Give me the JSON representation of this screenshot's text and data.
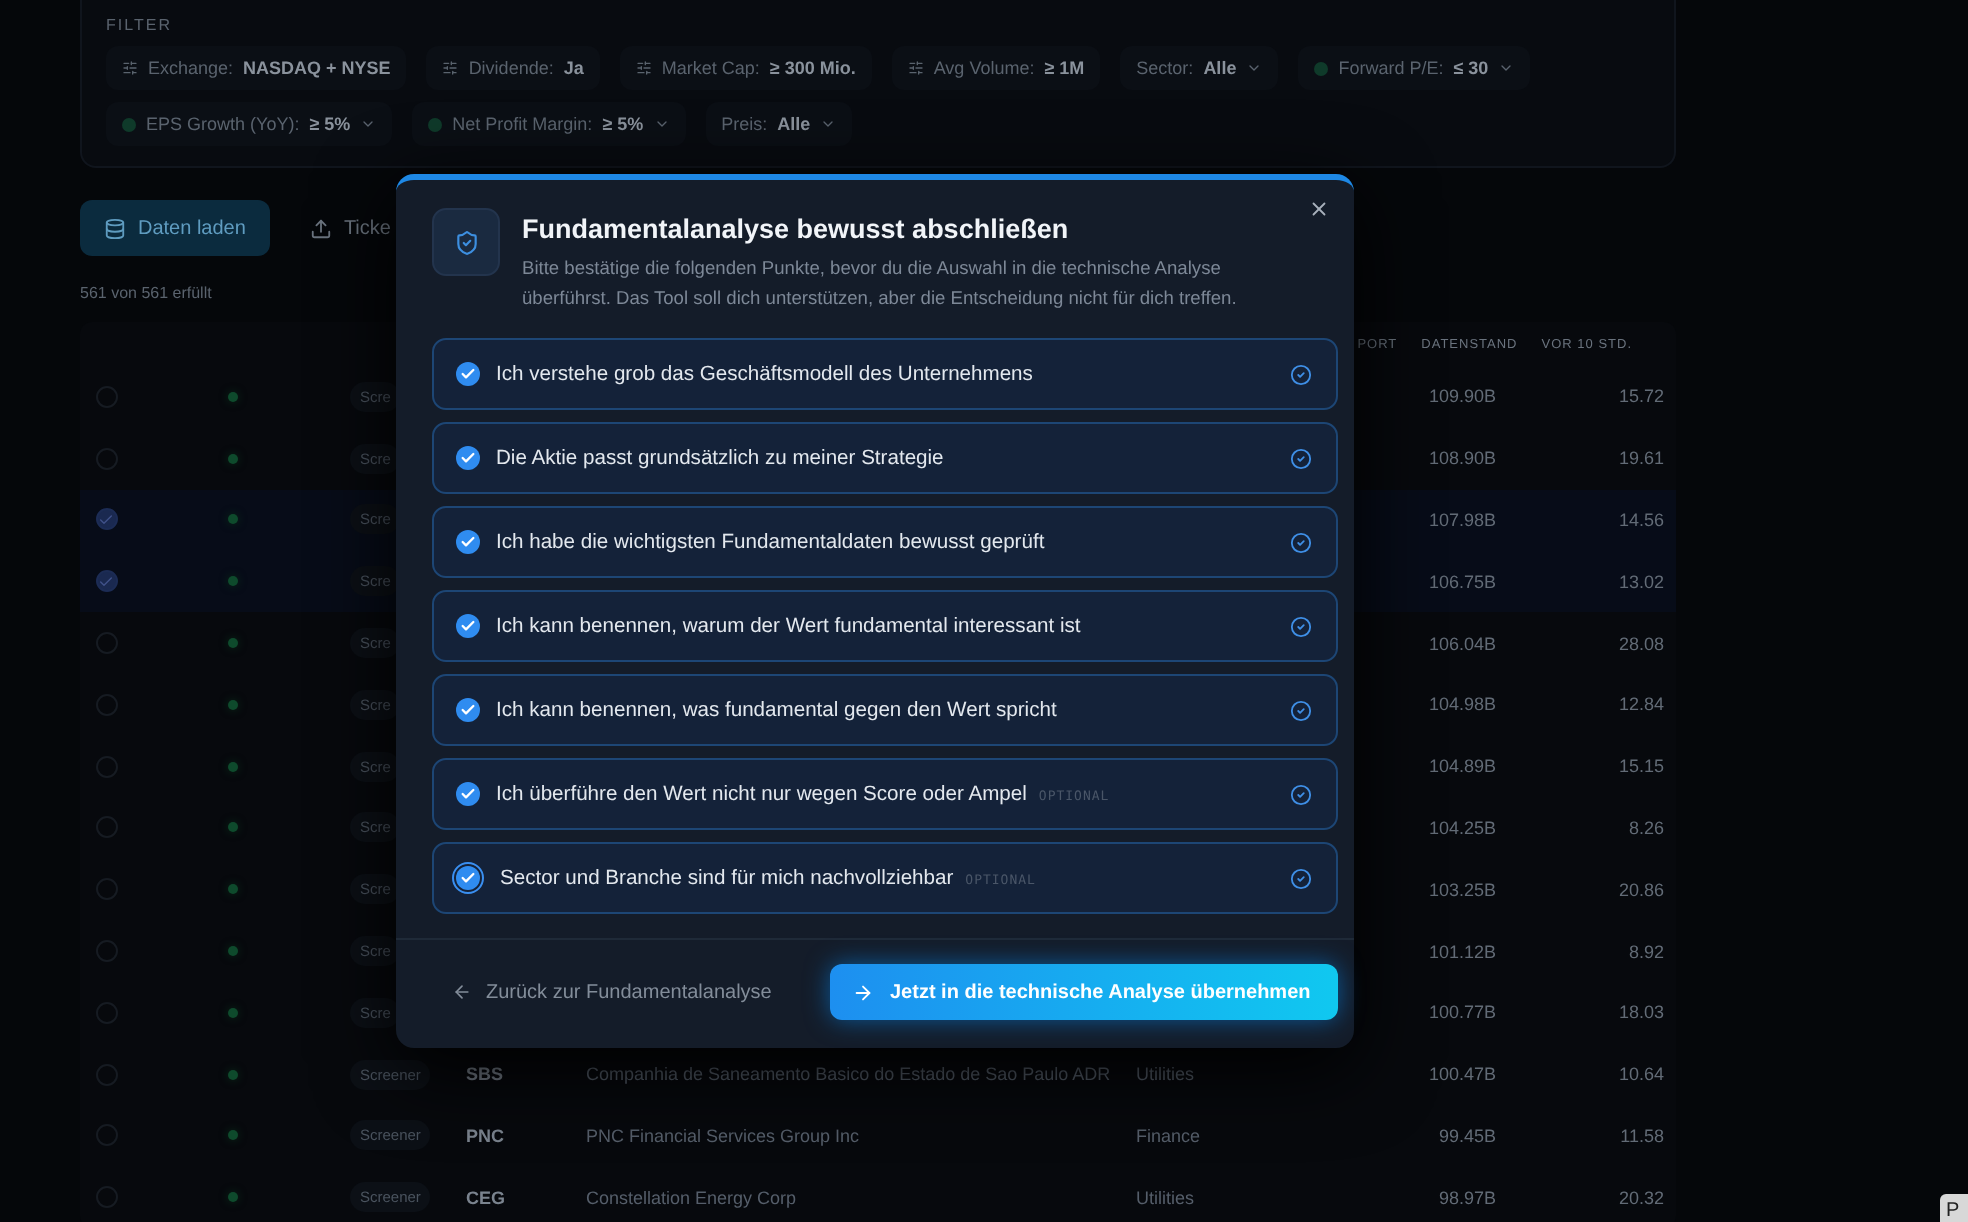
{
  "filter": {
    "title": "FILTER",
    "chips": [
      {
        "kind": "icon",
        "label": "Exchange:",
        "value": "NASDAQ + NYSE"
      },
      {
        "kind": "icon",
        "label": "Dividende:",
        "value": "Ja"
      },
      {
        "kind": "icon",
        "label": "Market Cap:",
        "value": "≥ 300 Mio."
      },
      {
        "kind": "icon",
        "label": "Avg Volume:",
        "value": "≥ 1M"
      },
      {
        "kind": "plain",
        "label": "Sector:",
        "value": "Alle"
      },
      {
        "kind": "dot",
        "label": "Forward P/E:",
        "value": "≤ 30"
      },
      {
        "kind": "dot",
        "label": "EPS Growth (YoY):",
        "value": "≥ 5%"
      },
      {
        "kind": "dot",
        "label": "Net Profit Margin:",
        "value": "≥ 5%"
      },
      {
        "kind": "plain",
        "label": "Preis:",
        "value": "Alle"
      }
    ]
  },
  "actions": {
    "load": "Daten laden",
    "ticker": "Ticke"
  },
  "count": "561 von 561 erfüllt",
  "table": {
    "columns": [
      "PORT",
      "DATENSTAND",
      "VOR 10 STD."
    ],
    "rows": [
      {
        "selected": false,
        "badge": "Scre",
        "market_cap": "109.90B",
        "pe": "15.72"
      },
      {
        "selected": false,
        "badge": "Scre",
        "market_cap": "108.90B",
        "pe": "19.61"
      },
      {
        "selected": true,
        "badge": "Scre",
        "market_cap": "107.98B",
        "pe": "14.56"
      },
      {
        "selected": true,
        "badge": "Scre",
        "market_cap": "106.75B",
        "pe": "13.02"
      },
      {
        "selected": false,
        "badge": "Scre",
        "market_cap": "106.04B",
        "pe": "28.08"
      },
      {
        "selected": false,
        "badge": "Scre",
        "market_cap": "104.98B",
        "pe": "12.84"
      },
      {
        "selected": false,
        "badge": "Scre",
        "market_cap": "104.89B",
        "pe": "15.15"
      },
      {
        "selected": false,
        "badge": "Scre",
        "market_cap": "104.25B",
        "pe": "8.26"
      },
      {
        "selected": false,
        "badge": "Scre",
        "market_cap": "103.25B",
        "pe": "20.86"
      },
      {
        "selected": false,
        "badge": "Scre",
        "market_cap": "101.12B",
        "pe": "8.92"
      },
      {
        "selected": false,
        "badge": "Scre",
        "market_cap": "100.77B",
        "pe": "18.03"
      },
      {
        "selected": false,
        "badge": "Screener",
        "ticker": "SBS",
        "name": "Companhia de Saneamento Basico do Estado de Sao Paulo ADR",
        "sector": "Utilities",
        "market_cap": "100.47B",
        "pe": "10.64"
      },
      {
        "selected": false,
        "badge": "Screener",
        "ticker": "PNC",
        "name": "PNC Financial Services Group Inc",
        "sector": "Finance",
        "market_cap": "99.45B",
        "pe": "11.58"
      },
      {
        "selected": false,
        "badge": "Screener",
        "ticker": "CEG",
        "name": "Constellation Energy Corp",
        "sector": "Utilities",
        "market_cap": "98.97B",
        "pe": "20.32"
      }
    ]
  },
  "corner_button": "P",
  "dialog": {
    "title": "Fundamentalanalyse bewusst abschließen",
    "text": "Bitte bestätige die folgenden Punkte, bevor du die Auswahl in die technische Analyse überführst. Das Tool soll dich unterstützen, aber die Entscheidung nicht für dich treffen.",
    "items": [
      {
        "label": "Ich verstehe grob das Geschäftsmodell des Unternehmens",
        "checked": true,
        "focused": false
      },
      {
        "label": "Die Aktie passt grundsätzlich zu meiner Strategie",
        "checked": true,
        "focused": false
      },
      {
        "label": "Ich habe die wichtigsten Fundamentaldaten bewusst geprüft",
        "checked": true,
        "focused": false
      },
      {
        "label": "Ich kann benennen, warum der Wert fundamental interessant ist",
        "checked": true,
        "focused": false
      },
      {
        "label": "Ich kann benennen, was fundamental gegen den Wert spricht",
        "checked": true,
        "focused": false
      },
      {
        "label": "Ich überführe den Wert nicht nur wegen Score oder Ampel",
        "tag": "OPTIONAL",
        "checked": true,
        "focused": false
      },
      {
        "label": "Sector und Branche sind für mich nachvollziehbar",
        "tag": "OPTIONAL",
        "checked": true,
        "focused": true
      }
    ],
    "back": "Zurück zur Fundamentalanalyse",
    "confirm": "Jetzt in die technische Analyse übernehmen"
  }
}
